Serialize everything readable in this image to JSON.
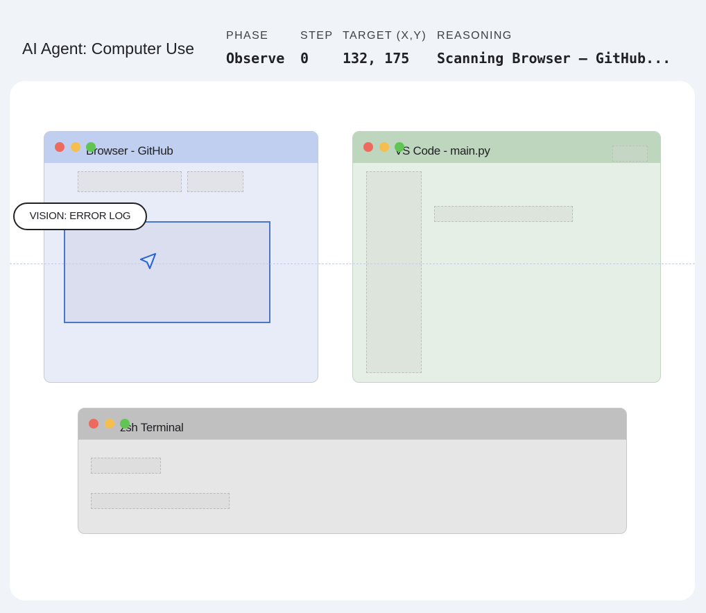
{
  "header": {
    "title": "AI Agent: Computer Use",
    "phase_label": "PHASE",
    "phase_value": "Observe",
    "step_label": "STEP",
    "step_value": "0",
    "target_label": "TARGET (X,Y)",
    "target_value": "132, 175",
    "reasoning_label": "REASONING",
    "reasoning_value": "Scanning Browser – GitHub..."
  },
  "windows": {
    "browser": {
      "title": "Browser - GitHub",
      "bar_color": "#c0cff0"
    },
    "vscode": {
      "title": "VS Code - main.py",
      "bar_color": "#bed6bd"
    },
    "terminal": {
      "title": "zsh Terminal",
      "bar_color": "#c0c0c0"
    }
  },
  "overlay": {
    "vision_label": "VISION: ERROR LOG",
    "cursor_icon": "cursor-arrow-icon",
    "focus_color": "#4a76c9"
  },
  "colors": {
    "close": "#ed6a5e",
    "minimize": "#f5bf4f",
    "maximize": "#61c554"
  }
}
